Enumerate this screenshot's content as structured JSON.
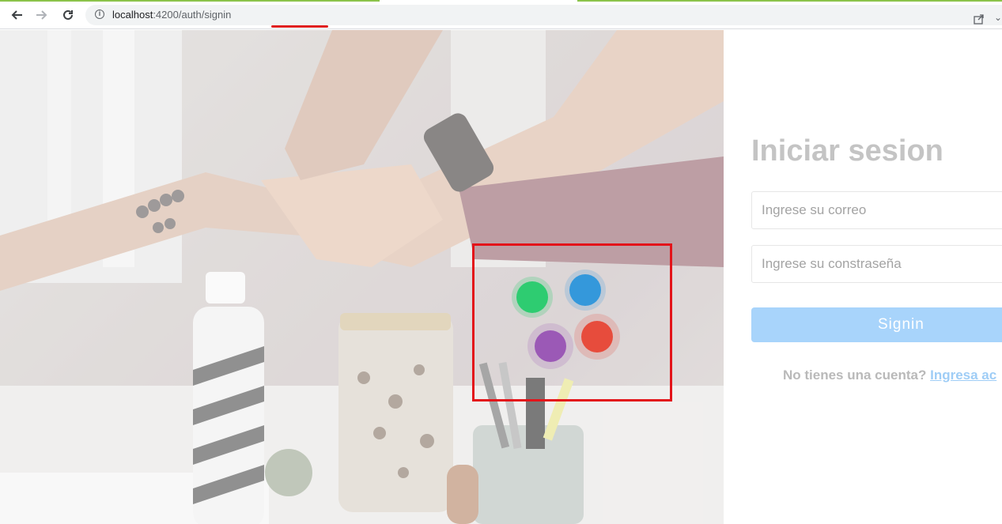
{
  "browser": {
    "url_host": "localhost",
    "url_port": ":4200",
    "url_path": "/auth/signin"
  },
  "icons": {
    "back": "back-arrow-icon",
    "forward": "forward-arrow-icon",
    "reload": "reload-icon",
    "info": "info-icon",
    "share": "share-icon"
  },
  "login": {
    "title": "Iniciar sesion",
    "email_placeholder": "Ingrese su correo",
    "password_placeholder": "Ingrese su constraseña",
    "signin_label": "Signin",
    "no_account_text": "No tienes una cuenta?",
    "signup_link": "Ingresa ac"
  },
  "loader": {
    "dot_colors": [
      "#2ecc71",
      "#3498db",
      "#9b59b6",
      "#e74c3c"
    ]
  }
}
